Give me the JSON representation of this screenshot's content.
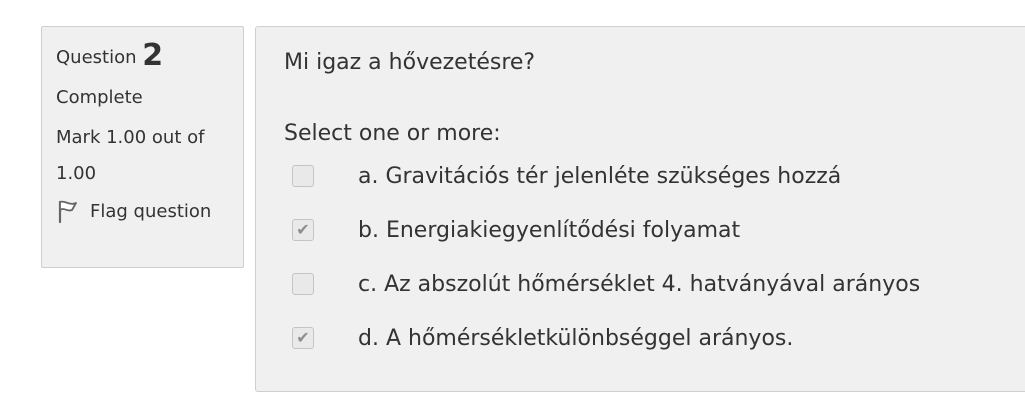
{
  "info": {
    "question_label": "Question",
    "question_number": "2",
    "state": "Complete",
    "grade": "Mark 1.00 out of 1.00",
    "flag_label": "Flag question"
  },
  "question": {
    "text": "Mi igaz a hővezetésre?",
    "prompt": "Select one or more:",
    "answers": [
      {
        "label": "a. Gravitációs tér jelenléte szükséges hozzá",
        "checked": false
      },
      {
        "label": "b. Energiakiegyenlítődési folyamat",
        "checked": true
      },
      {
        "label": "c. Az abszolút hőmérséklet 4. hatványával arányos",
        "checked": false
      },
      {
        "label": "d. A hőmérsékletkülönbséggel arányos.",
        "checked": true
      }
    ]
  },
  "icons": {
    "flag": "flag-icon",
    "check": "checkmark-icon"
  }
}
